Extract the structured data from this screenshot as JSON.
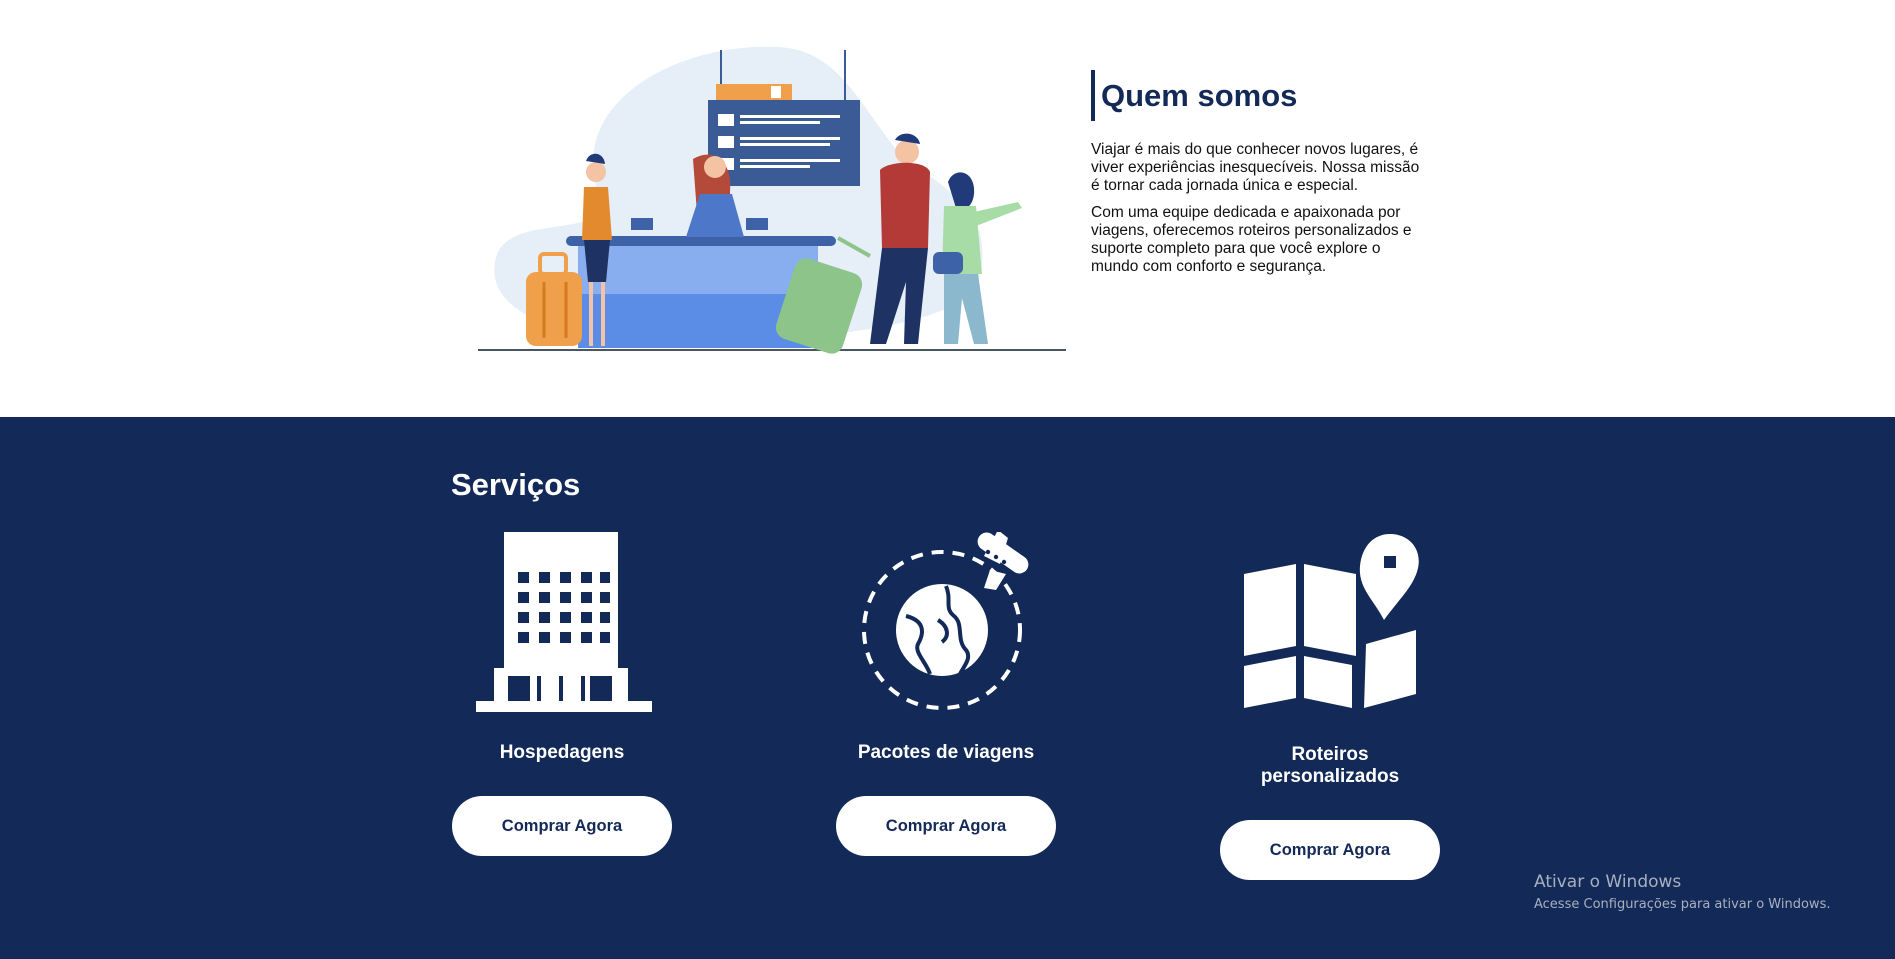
{
  "about": {
    "title": "Quem somos",
    "paragraph_1": "Viajar é mais do que conhecer novos lugares, é viver experiências inesquecíveis. Nossa missão é tornar cada jornada única e especial.",
    "paragraph_2": "Com uma equipe dedicada e apaixonada por viagens, oferecemos roteiros personalizados e suporte completo para que você explore o mundo com conforto e segurança."
  },
  "services": {
    "title": "Serviços",
    "items": [
      {
        "label": "Hospedagens",
        "button": "Comprar Agora",
        "icon": "hotel-building-icon"
      },
      {
        "label": "Pacotes de viagens",
        "button": "Comprar Agora",
        "icon": "globe-plane-icon"
      },
      {
        "label": "Roteiros personalizados",
        "button": "Comprar Agora",
        "icon": "map-pin-icon"
      }
    ]
  },
  "watermark": {
    "line_1": "Ativar o Windows",
    "line_2": "Acesse Configurações para ativar o Windows."
  },
  "colors": {
    "brand_navy": "#132a58",
    "white": "#ffffff"
  }
}
